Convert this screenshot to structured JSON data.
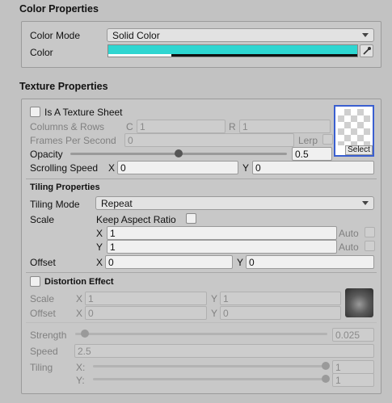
{
  "color_properties": {
    "header": "Color Properties",
    "color_mode_label": "Color Mode",
    "color_mode_value": "Solid Color",
    "color_label": "Color",
    "color_swatch": "#2ed6d1"
  },
  "texture_properties": {
    "header": "Texture Properties",
    "is_texture_sheet_label": "Is A Texture Sheet",
    "columns_rows_label": "Columns & Rows",
    "c_label": "C",
    "c_value": "1",
    "r_label": "R",
    "r_value": "1",
    "fps_label": "Frames Per Second",
    "fps_value": "0",
    "lerp_label": "Lerp",
    "opacity_label": "Opacity",
    "opacity_value": "0.5",
    "opacity_fraction": 0.5,
    "scrolling_speed_label": "Scrolling Speed",
    "scroll_x_label": "X",
    "scroll_x_value": "0",
    "scroll_y_label": "Y",
    "scroll_y_value": "0",
    "select_label": "Select"
  },
  "tiling_properties": {
    "header": "Tiling Properties",
    "tiling_mode_label": "Tiling Mode",
    "tiling_mode_value": "Repeat",
    "scale_label": "Scale",
    "keep_aspect_label": "Keep Aspect Ratio",
    "scale_x_label": "X",
    "scale_x_value": "1",
    "scale_y_label": "Y",
    "scale_y_value": "1",
    "auto_label": "Auto",
    "offset_label": "Offset",
    "offset_x_label": "X",
    "offset_x_value": "0",
    "offset_y_label": "Y",
    "offset_y_value": "0"
  },
  "distortion": {
    "header": "Distortion Effect",
    "scale_label": "Scale",
    "scale_x_label": "X",
    "scale_x_value": "1",
    "scale_y_label": "Y",
    "scale_y_value": "1",
    "offset_label": "Offset",
    "offset_x_label": "X",
    "offset_x_value": "0",
    "offset_y_label": "Y",
    "offset_y_value": "0",
    "strength_label": "Strength",
    "strength_value": "0.025",
    "speed_label": "Speed",
    "speed_value": "2.5",
    "tiling_label": "Tiling",
    "tiling_x_label": "X:",
    "tiling_x_value": "1",
    "tiling_y_label": "Y:",
    "tiling_y_value": "1"
  }
}
